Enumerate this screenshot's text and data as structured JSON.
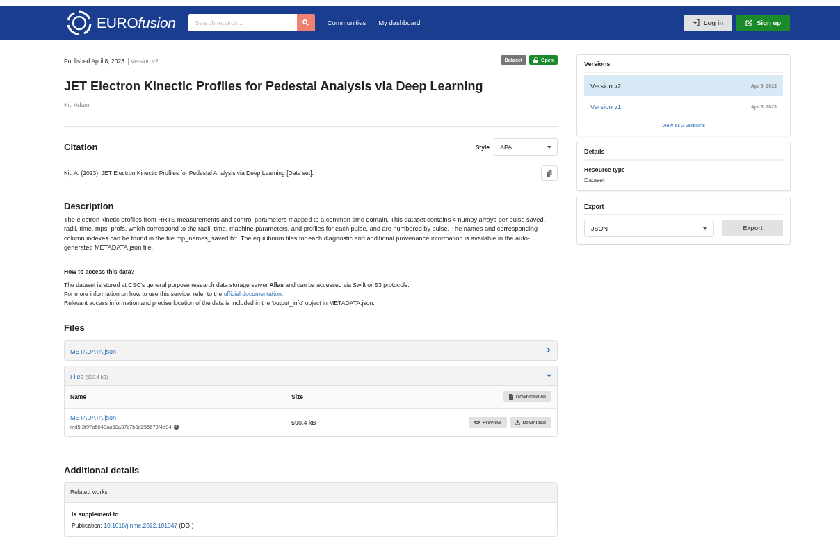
{
  "header": {
    "logo": "EURO",
    "logo_italic": "fusion",
    "search": {
      "placeholder": "Search records..."
    },
    "nav": [
      {
        "label": "Communities"
      },
      {
        "label": "My dashboard"
      }
    ],
    "actions": [
      {
        "label": "Log in",
        "kind": "login"
      },
      {
        "label": "Sign up",
        "kind": "signup"
      }
    ]
  },
  "record": {
    "published": "Published April 8, 2023",
    "version": "| Version v2",
    "badges": [
      {
        "label": "Dataset",
        "kind": "type"
      },
      {
        "label": "Open",
        "kind": "access"
      }
    ],
    "title": "JET Electron Kinectic Profiles for Pedestal Analysis via Deep Learning",
    "creators": "Kit, Adam"
  },
  "citation": {
    "heading": "Citation",
    "style_label": "Style",
    "style_value": "APA",
    "text": "Kit, A. (2023). JET Electron Kinectic Profiles for Pedestal Analysis via Deep Learning [Data set]."
  },
  "description": {
    "heading": "Description",
    "paragraph": "The electron kinetic profiles from HRTS measurements and control parameters mapped to a common time domain. This dataset contains 4 numpy arrays per pulse saved, radii, time, mps, profs, which correspond to the radii, time, machine parameters, and profiles for each pulse, and are numbered by pulse. The names and corresponding column indexes can be found in the file mp_names_saved.txt. The equilibrium files for each diagnostic and additional provenance information is available in the auto-generated METADATA.json file.",
    "subheading": "How to access this data?",
    "lines": [
      {
        "text": "The dataset is stored at CSC's general purpose research data storage server **Allas** and can be accessed via Swift or S3 protocols."
      },
      {
        "text": "For more information on how to use this service, refer to the ",
        "link": "official documentation."
      },
      {
        "text": "Relevant access information and precise location of the data is included in the 'output_info' object in METADATA.json."
      }
    ]
  },
  "files": {
    "heading": "Files",
    "panels": [
      {
        "title": "METADATA.json",
        "expanded": false
      },
      {
        "title": "Files",
        "size": "(590.4 kB)",
        "expanded": true,
        "columns": [
          "Name",
          "Size"
        ],
        "download_all": "Download all",
        "rows": [
          {
            "name": "METADATA.json",
            "checksum": "md5:3f97a5048aa60a37c7b8d255678f4a94",
            "size": "590.4 kB",
            "preview": "Preview",
            "download": "Download"
          }
        ]
      }
    ]
  },
  "additional": {
    "heading": "Additional details",
    "panel_title": "Related works",
    "relation": "Is supplement to",
    "prefix": "Publication: ",
    "link": "10.1016/j.nme.2022.101347",
    "suffix": " (DOI)"
  },
  "sidebar": {
    "versions": {
      "heading": "Versions",
      "items": [
        {
          "label": "Version v2",
          "date": "Apr 8, 2023",
          "selected": true
        },
        {
          "label": "Version v1",
          "date": "Apr 8, 2023",
          "selected": false
        }
      ],
      "view_all": "View all 2 versions"
    },
    "details": {
      "heading": "Details",
      "label": "Resource type",
      "value": "Dataset"
    },
    "export": {
      "heading": "Export",
      "format": "JSON",
      "button": "Export"
    }
  }
}
